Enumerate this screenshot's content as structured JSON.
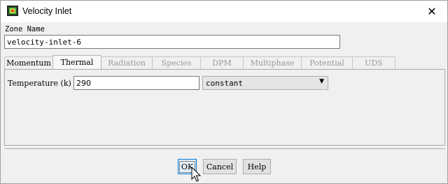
{
  "window": {
    "title": "Velocity Inlet",
    "close_glyph": "✕"
  },
  "zone": {
    "label": "Zone Name",
    "value": "velocity-inlet-6"
  },
  "tabs": [
    {
      "label": "Momentum",
      "enabled": true,
      "active": false
    },
    {
      "label": "Thermal",
      "enabled": true,
      "active": true
    },
    {
      "label": "Radiation",
      "enabled": false,
      "active": false
    },
    {
      "label": "Species",
      "enabled": false,
      "active": false
    },
    {
      "label": "DPM",
      "enabled": false,
      "active": false
    },
    {
      "label": "Multiphase",
      "enabled": false,
      "active": false
    },
    {
      "label": "Potential",
      "enabled": false,
      "active": false
    },
    {
      "label": "UDS",
      "enabled": false,
      "active": false
    }
  ],
  "thermal": {
    "temperature_label": "Temperature (k)",
    "temperature_value": "290",
    "method_value": "constant",
    "arrow_glyph": "▼"
  },
  "buttons": {
    "ok": "OK",
    "cancel": "Cancel",
    "help": "Help"
  },
  "icons": {
    "app": "fluent-app-icon",
    "close": "close-icon",
    "dropdown": "chevron-down-icon",
    "cursor": "mouse-pointer-icon"
  },
  "colors": {
    "focus_border": "#0078d7",
    "disabled_text": "#9a9a9a"
  }
}
